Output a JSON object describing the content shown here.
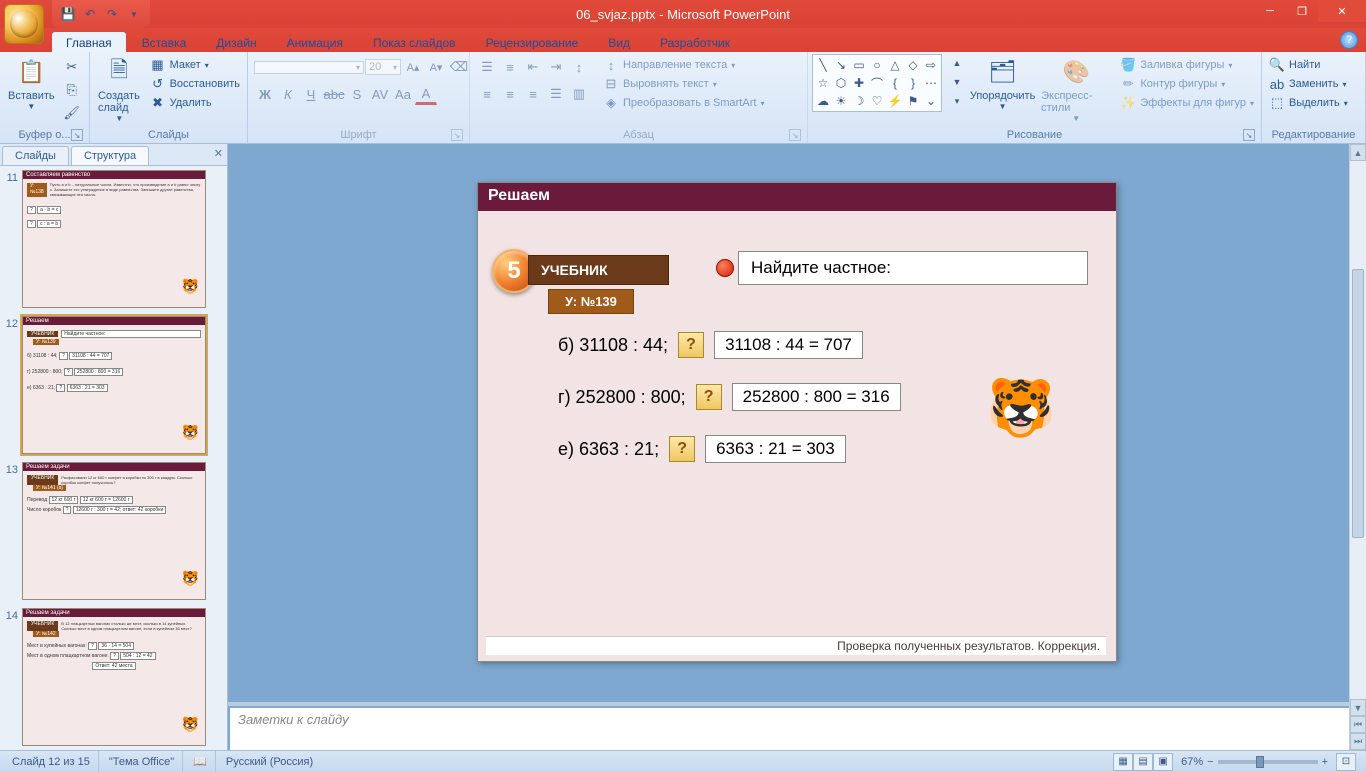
{
  "window": {
    "title": "06_svjaz.pptx - Microsoft PowerPoint"
  },
  "tabs": {
    "home": "Главная",
    "insert": "Вставка",
    "design": "Дизайн",
    "animation": "Анимация",
    "slideshow": "Показ слайдов",
    "review": "Рецензирование",
    "view": "Вид",
    "developer": "Разработчик"
  },
  "ribbon": {
    "paste": "Вставить",
    "clipboard_group": "Буфер о...",
    "new_slide": "Создать слайд",
    "layout": "Макет",
    "reset": "Восстановить",
    "delete": "Удалить",
    "slides_group": "Слайды",
    "font_size": "20",
    "font_group": "Шрифт",
    "text_direction": "Направление текста",
    "align_text": "Выровнять текст",
    "convert_smartart": "Преобразовать в SmartArt",
    "paragraph_group": "Абзац",
    "arrange": "Упорядочить",
    "quick_styles": "Экспресс-стили",
    "shape_fill": "Заливка фигуры",
    "shape_outline": "Контур фигуры",
    "shape_effects": "Эффекты для фигур",
    "drawing_group": "Рисование",
    "find": "Найти",
    "replace": "Заменить",
    "select": "Выделить",
    "editing_group": "Редактирование"
  },
  "panel": {
    "slides_tab": "Слайды",
    "outline_tab": "Структура",
    "thumb11_title": "Составляем равенство",
    "thumb12_title": "Решаем",
    "thumb13_title": "Решаем задачи",
    "thumb14_title": "Решаем задачи"
  },
  "slide": {
    "title": "Решаем",
    "badge": "5",
    "topic": "УЧЕБНИК",
    "ref": "У: №139",
    "task": "Найдите частное:",
    "p1_label": "б) 31108 : 44;",
    "p1_answer": "31108 : 44 = 707",
    "p2_label": "г) 252800 : 800;",
    "p2_answer": "252800 : 800 = 316",
    "p3_label": "е) 6363 : 21;",
    "p3_answer": "6363 : 21 = 303",
    "q": "?",
    "footer": "Проверка полученных результатов. Коррекция."
  },
  "notes": {
    "placeholder": "Заметки к слайду"
  },
  "status": {
    "slide_info": "Слайд 12 из 15",
    "theme": "\"Тема Office\"",
    "language": "Русский (Россия)",
    "zoom": "67%"
  }
}
